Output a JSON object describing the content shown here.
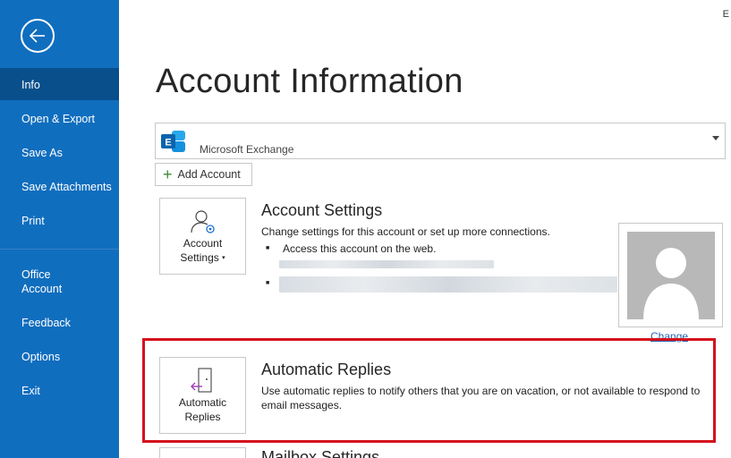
{
  "sidebar": {
    "items": [
      {
        "label": "Info"
      },
      {
        "label": "Open & Export"
      },
      {
        "label": "Save As"
      },
      {
        "label": "Save Attachments"
      },
      {
        "label": "Print"
      },
      {
        "label": "Office\nAccount"
      },
      {
        "label": "Feedback"
      },
      {
        "label": "Options"
      },
      {
        "label": "Exit"
      }
    ]
  },
  "corner_text": "E",
  "page_title": "Account Information",
  "account_selector": {
    "name": "Microsoft Exchange"
  },
  "add_account_label": "Add Account",
  "account_settings": {
    "button_line1": "Account",
    "button_line2": "Settings",
    "title": "Account Settings",
    "description": "Change settings for this account or set up more connections.",
    "bullet1": "Access this account on the web."
  },
  "change_link": "Change",
  "automatic_replies": {
    "button_line1": "Automatic",
    "button_line2": "Replies",
    "title": "Automatic Replies",
    "description": "Use automatic replies to notify others that you are on vacation, or not available to respond to email messages."
  },
  "mailbox_settings": {
    "title": "Mailbox Settings"
  },
  "colors": {
    "sidebar": "#106ebe",
    "highlight": "#d4111c",
    "link": "#2563b0"
  }
}
